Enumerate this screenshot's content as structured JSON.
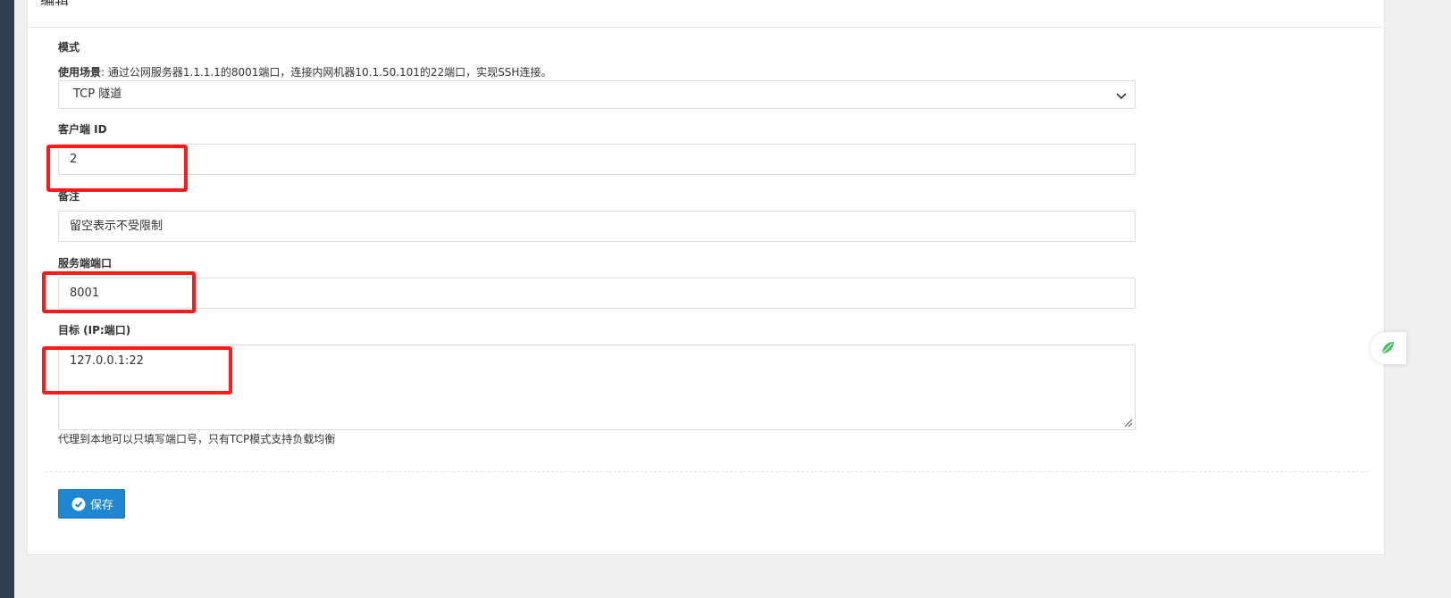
{
  "panel": {
    "title": "编辑"
  },
  "form": {
    "mode": {
      "label": "模式",
      "help_bold": "使用场景",
      "help_text": ": 通过公网服务器1.1.1.1的8001端口，连接内网机器10.1.50.101的22端口，实现SSH连接。",
      "selected": "TCP 隧道"
    },
    "client_id": {
      "label": "客户端 ID",
      "value": "2"
    },
    "remark": {
      "label": "备注",
      "placeholder": "留空表示不受限制"
    },
    "server_port": {
      "label": "服务端端口",
      "value": "8001"
    },
    "target": {
      "label": "目标 (IP:端口)",
      "value": "127.0.0.1:22",
      "help": "代理到本地可以只填写端口号，只有TCP模式支持负载均衡"
    }
  },
  "actions": {
    "save_label": "保存"
  },
  "colors": {
    "primary": "#1f86d4",
    "highlight": "#ff1a1a",
    "sidebar": "#2c3e50"
  },
  "icons": {
    "save": "check-circle-icon",
    "select": "chevron-down-icon",
    "float": "leaf-icon"
  }
}
